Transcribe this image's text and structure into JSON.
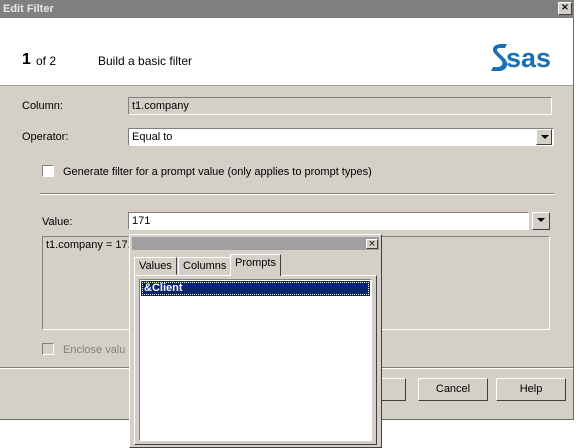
{
  "window": {
    "title": "Edit Filter",
    "close_glyph": "×"
  },
  "header": {
    "step_number": "1",
    "step_of": "of 2",
    "step_title": "Build a basic filter",
    "logo": "sas"
  },
  "form": {
    "column_label": "Column:",
    "column_value": "t1.company",
    "operator_label": "Operator:",
    "operator_value": "Equal to",
    "generate_checkbox_label": "Generate filter for a prompt value (only applies to prompt types)",
    "value_label": "Value:",
    "value_value": "171",
    "expression": "t1.company = 171",
    "enclose_label": "Enclose valu"
  },
  "buttons": {
    "cancel": "Cancel",
    "help": "Help"
  },
  "popup": {
    "close_glyph": "×",
    "tabs": [
      "Values",
      "Columns",
      "Prompts"
    ],
    "active_tab": "Prompts",
    "items": [
      "&Client"
    ]
  },
  "colors": {
    "dialog_bg": "#d4d0c8",
    "titlebar": "#808080",
    "selection": "#0a246a",
    "logo_blue": "#1a6fb5"
  }
}
